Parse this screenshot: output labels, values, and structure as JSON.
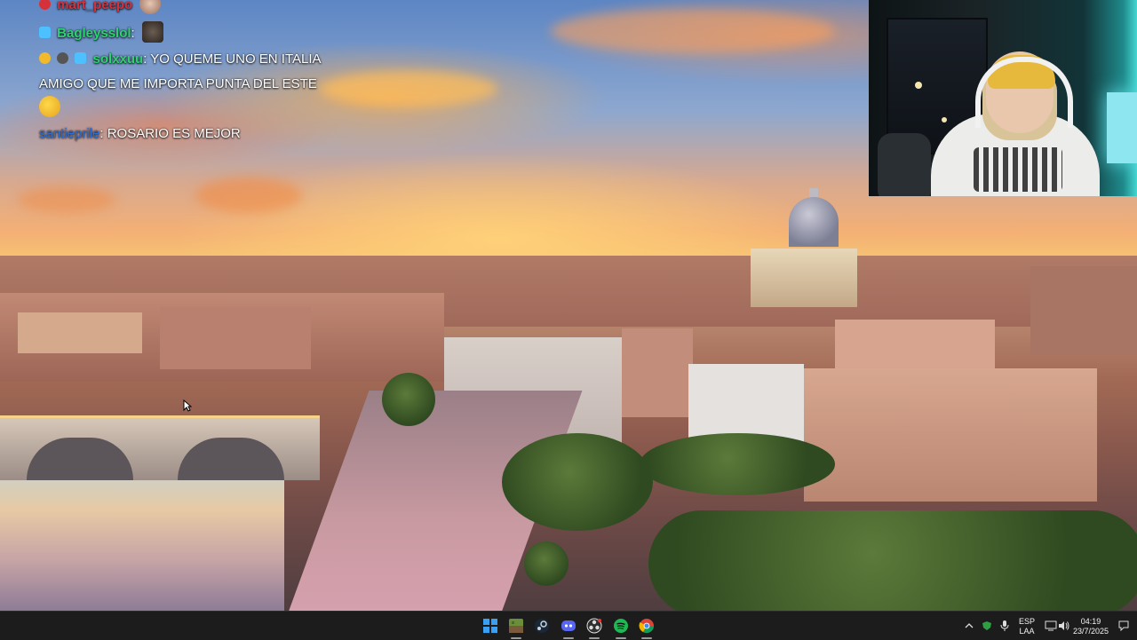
{
  "chat": {
    "messages": [
      {
        "username": "mart_peepo",
        "username_color": "#d6313b",
        "text": "",
        "badges": [
          "red-star-badge"
        ],
        "emote": "pepe-emote"
      },
      {
        "username": "Bagleysslol",
        "username_color": "#2dd36f",
        "text": "",
        "badges": [
          "blue-cube-badge"
        ],
        "emote": "face-emote"
      },
      {
        "username": "solxxuu",
        "username_color": "#2dd36f",
        "text": "YO QUEME UNO EN ITALIA",
        "badges": [
          "gold-coin-badge",
          "mask-badge",
          "blue-cube-badge"
        ],
        "emote": ""
      },
      {
        "username": "",
        "username_color": "",
        "text": "AMIGO QUE ME IMPORTA PUNTA DEL ESTE",
        "badges": [],
        "emote": ""
      },
      {
        "username": "",
        "username_color": "",
        "text": "",
        "badges": [],
        "emote": "duck-emote"
      },
      {
        "username": "santieprile",
        "username_color": "#2b6fd8",
        "text": "ROSARIO ES MEJOR",
        "badges": [],
        "emote": ""
      }
    ]
  },
  "taskbar": {
    "pinned_apps": [
      {
        "name": "windows-start-icon"
      },
      {
        "name": "minecraft-icon"
      },
      {
        "name": "steam-icon"
      },
      {
        "name": "discord-icon"
      },
      {
        "name": "obs-icon"
      },
      {
        "name": "spotify-icon"
      },
      {
        "name": "chrome-icon"
      }
    ],
    "tray": {
      "language_line1": "ESP",
      "language_line2": "LAA",
      "time": "04:19",
      "date": "23/7/2025"
    }
  },
  "colors": {
    "taskbar_bg": "#1c1c1c",
    "spotify_green": "#1db954",
    "discord_blurple": "#5865f2",
    "windows_blue": "#3aa0f3"
  }
}
